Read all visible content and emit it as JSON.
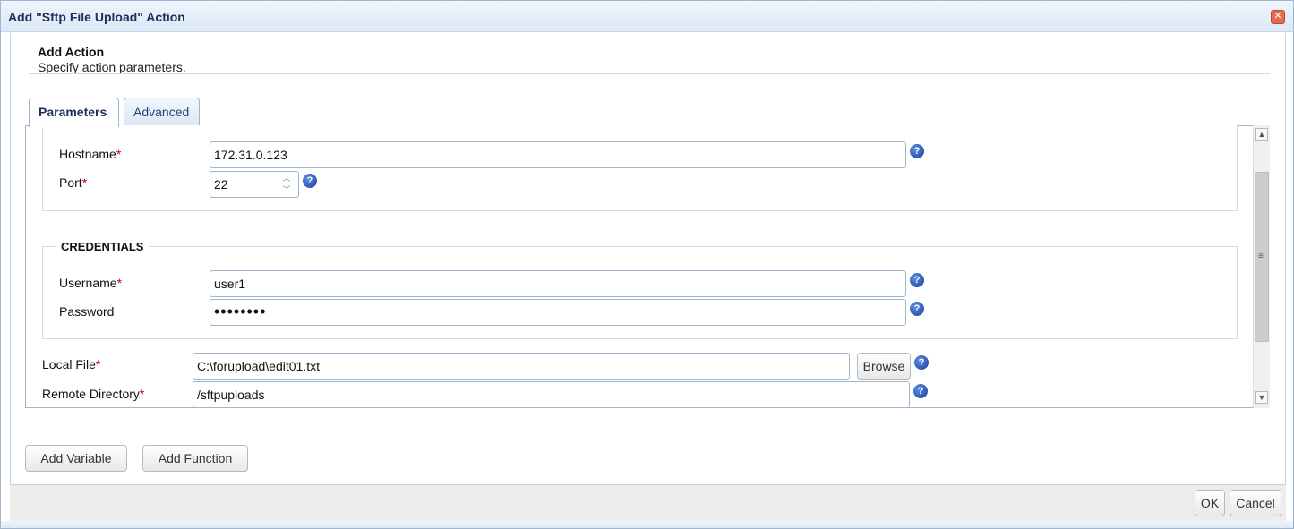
{
  "window": {
    "title": "Add \"Sftp File Upload\" Action",
    "close_glyph": "✕"
  },
  "header": {
    "title": "Add Action",
    "subtitle": "Specify action parameters."
  },
  "tabs": [
    {
      "label": "Parameters",
      "active": true
    },
    {
      "label": "Advanced",
      "active": false
    }
  ],
  "fields": {
    "hostname": {
      "label": "Hostname",
      "required_mark": "*",
      "value": "172.31.0.123"
    },
    "port": {
      "label": "Port",
      "required_mark": "*",
      "value": "22"
    },
    "username": {
      "label": "Username",
      "required_mark": "*",
      "value": "user1"
    },
    "password": {
      "label": "Password",
      "value": "••••••••"
    },
    "local_file": {
      "label": "Local File",
      "required_mark": "*",
      "value": "C:\\forupload\\edit01.txt"
    },
    "remote_directory": {
      "label": "Remote Directory",
      "required_mark": "*",
      "value": "/sftpuploads"
    }
  },
  "credentials_legend": "CREDENTIALS",
  "buttons": {
    "browse": "Browse",
    "add_variable": "Add Variable",
    "add_function": "Add Function",
    "ok": "OK",
    "cancel": "Cancel"
  },
  "icons": {
    "help": "?",
    "spin_up": "︿",
    "spin_down": "﹀",
    "scroll_up": "▲",
    "scroll_down": "▼",
    "scroll_grip": "≡"
  },
  "colors": {
    "accent": "#1c2f5a",
    "required": "#cc0000",
    "help_icon": "#1a3f9e"
  }
}
